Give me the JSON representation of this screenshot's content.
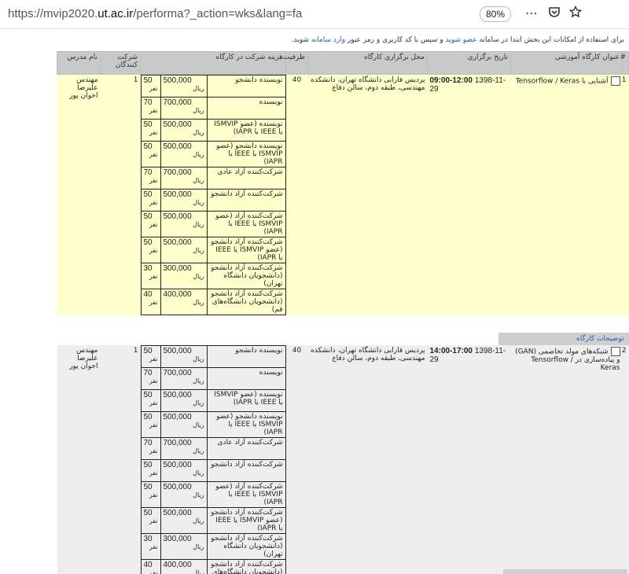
{
  "browser": {
    "url_prefix": "https://mvip2020.",
    "url_domain": "ut.ac.ir",
    "url_suffix": "/performa?_action=wks&lang=fa",
    "zoom": "80%"
  },
  "notice": {
    "part1": "برای استفاده از امکانات این بخش ابتدا در سامانه ",
    "link1": "عضو شوید",
    "part2": " و سپس با کد کاربری و رمز عبور ",
    "link2": "وارد سامانه",
    "part3": " شوید."
  },
  "headers": {
    "num": "#",
    "title": "عنوان کارگاه آموزشی",
    "date": "تاریخ برگزاری",
    "venue": "محل برگزاری کارگاه",
    "capacity": "ظرفیت",
    "fee": "هزینه شرکت در کارگاه",
    "registered": "شرکت کنندگان",
    "instructor": "نام مدرس"
  },
  "workshops": [
    {
      "num": "1",
      "title": "آشنایی با Tensorflow / Keras",
      "date": "1398-11-29",
      "time": "09:00-12:00",
      "venue": "پردیس فارابی دانشگاه تهران، دانشکده مهندسی، طبقه دوم، سالن دفاع",
      "capacity": "40",
      "registered": "1",
      "instructor": "مهندس علیرضا اخوان پور",
      "fees": [
        {
          "label": "نویسنده دانشجو",
          "price": "500,000",
          "unit": "ریال",
          "cap": "50",
          "cap_unit": "نفر"
        },
        {
          "label": "نویسنده",
          "price": "700,000",
          "unit": "ریال",
          "cap": "70",
          "cap_unit": "نفر"
        },
        {
          "label": "نویسنده (عضو ISMVIP یا IEEE یا IAPR)",
          "price": "500,000",
          "unit": "ریال",
          "cap": "50",
          "cap_unit": "نفر"
        },
        {
          "label": "نویسنده دانشجو (عضو ISMVIP یا IEEE یا IAPR)",
          "price": "500,000",
          "unit": "ریال",
          "cap": "50",
          "cap_unit": "نفر"
        },
        {
          "label": "شرکت‌کننده آزاد عادی",
          "price": "700,000",
          "unit": "ریال",
          "cap": "70",
          "cap_unit": "نفر"
        },
        {
          "label": "شرکت‌کننده آزاد دانشجو",
          "price": "500,000",
          "unit": "ریال",
          "cap": "50",
          "cap_unit": "نفر"
        },
        {
          "label": "شرکت‌کننده آزاد (عضو ISMVIP یا IEEE یا IAPR)",
          "price": "500,000",
          "unit": "ریال",
          "cap": "50",
          "cap_unit": "نفر"
        },
        {
          "label": "شرکت‌کننده آزاد دانشجو (عضو ISMVIP یا IEEE یا IAPR)",
          "price": "500,000",
          "unit": "ریال",
          "cap": "50",
          "cap_unit": "نفر"
        },
        {
          "label": "شرکت‌کننده آزاد دانشجو (دانشجویان دانشگاه تهران)",
          "price": "300,000",
          "unit": "ریال",
          "cap": "30",
          "cap_unit": "نفر"
        },
        {
          "label": "شرکت‌کننده آزاد دانشجو (دانشجویان دانشگاه‌های قم)",
          "price": "400,000",
          "unit": "ریال",
          "cap": "40",
          "cap_unit": "نفر"
        }
      ]
    },
    {
      "num": "2",
      "title": "شبکه‌های مولد تخاصمی (GAN) و پیاده‌سازی در Tensorflow / Keras",
      "date": "1398-11-29",
      "time": "14:00-17:00",
      "venue": "پردیس فارابی دانشگاه تهران، دانشکده مهندسی، طبقه دوم، سالن دفاع",
      "capacity": "40",
      "registered": "1",
      "instructor": "مهندس علیرضا اخوان پور",
      "fees": [
        {
          "label": "نویسنده دانشجو",
          "price": "500,000",
          "unit": "ریال",
          "cap": "50",
          "cap_unit": "نفر"
        },
        {
          "label": "نویسنده",
          "price": "700,000",
          "unit": "ریال",
          "cap": "70",
          "cap_unit": "نفر"
        },
        {
          "label": "نویسنده (عضو ISMVIP یا IEEE یا IAPR)",
          "price": "500,000",
          "unit": "ریال",
          "cap": "50",
          "cap_unit": "نفر"
        },
        {
          "label": "نویسنده دانشجو (عضو ISMVIP یا IEEE یا IAPR)",
          "price": "500,000",
          "unit": "ریال",
          "cap": "50",
          "cap_unit": "نفر"
        },
        {
          "label": "شرکت‌کننده آزاد عادی",
          "price": "700,000",
          "unit": "ریال",
          "cap": "70",
          "cap_unit": "نفر"
        },
        {
          "label": "شرکت‌کننده آزاد دانشجو",
          "price": "500,000",
          "unit": "ریال",
          "cap": "50",
          "cap_unit": "نفر"
        },
        {
          "label": "شرکت‌کننده آزاد (عضو ISMVIP یا IEEE یا IAPR)",
          "price": "500,000",
          "unit": "ریال",
          "cap": "50",
          "cap_unit": "نفر"
        },
        {
          "label": "شرکت‌کننده آزاد دانشجو (عضو ISMVIP یا IEEE یا IAPR)",
          "price": "500,000",
          "unit": "ریال",
          "cap": "50",
          "cap_unit": "نفر"
        },
        {
          "label": "شرکت‌کننده آزاد دانشجو (دانشجویان دانشگاه تهران)",
          "price": "300,000",
          "unit": "ریال",
          "cap": "30",
          "cap_unit": "نفر"
        },
        {
          "label": "شرکت‌کننده آزاد دانشجو (دانشجویان دانشگاه‌های قم)",
          "price": "400,000",
          "unit": "ریال",
          "cap": "40",
          "cap_unit": "نفر"
        }
      ]
    }
  ],
  "comments_link": "توضیحات کارگاه",
  "icons": [
    "more-icon",
    "pocket-icon",
    "bookmark-star-icon",
    "checkbox-icon"
  ]
}
